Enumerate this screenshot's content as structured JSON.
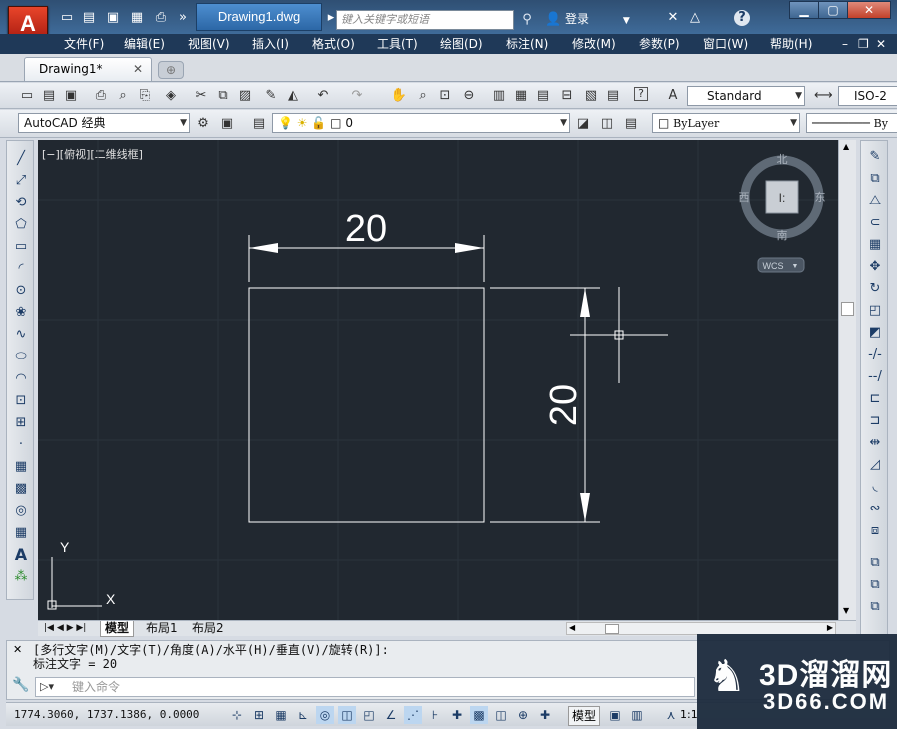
{
  "title": {
    "logo": "A",
    "doc_title": "Drawing1.dwg",
    "search_placeholder": "键入关键字或短语",
    "login": "登录",
    "help": "?"
  },
  "menu": [
    "文件(F)",
    "编辑(E)",
    "视图(V)",
    "插入(I)",
    "格式(O)",
    "工具(T)",
    "绘图(D)",
    "标注(N)",
    "修改(M)",
    "参数(P)",
    "窗口(W)",
    "帮助(H)"
  ],
  "tabs": {
    "file_tab": "Drawing1*",
    "close": "✕"
  },
  "toolbar": {
    "text_style": "Standard",
    "dim_style": "ISO-2",
    "workspace": "AutoCAD 经典",
    "layer": "0",
    "color": "ByLayer",
    "linetype": "By"
  },
  "viewport": {
    "label": "[−][俯视][二维线框]",
    "compass": {
      "north": "北",
      "south": "南",
      "east": "东",
      "west": "西"
    },
    "wcs": "WCS",
    "ucs_x": "X",
    "ucs_y": "Y"
  },
  "drawing": {
    "dim_horizontal": "20",
    "dim_vertical": "20"
  },
  "layout_tabs": [
    "模型",
    "布局1",
    "布局2"
  ],
  "command": {
    "line1": "[多行文字(M)/文字(T)/角度(A)/水平(H)/垂直(V)/旋转(R)]:",
    "line2": "标注文字 = 20",
    "placeholder": "键入命令"
  },
  "status": {
    "coords": "1774.3060, 1737.1386, 0.0000",
    "model": "模型",
    "scale": "1:1"
  },
  "watermark": {
    "big": "3D溜溜网",
    "small": "3D66.COM"
  }
}
